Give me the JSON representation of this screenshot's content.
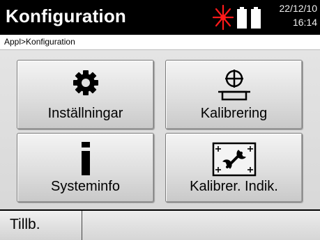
{
  "header": {
    "title": "Konfiguration",
    "date": "22/12/10",
    "time": "16:14",
    "icons": [
      "laser-icon",
      "battery-icon",
      "battery-icon"
    ],
    "laser_color": "#ff0000"
  },
  "breadcrumb": "Appl>Konfiguration",
  "tiles": [
    {
      "label": "Inställningar",
      "icon": "gear-icon"
    },
    {
      "label": "Kalibrering",
      "icon": "level-target-icon"
    },
    {
      "label": "Systeminfo",
      "icon": "info-icon"
    },
    {
      "label": "Kalibrer. Indik.",
      "icon": "wrench-frame-icon"
    }
  ],
  "footer": {
    "softkey_label": "Tillb."
  }
}
